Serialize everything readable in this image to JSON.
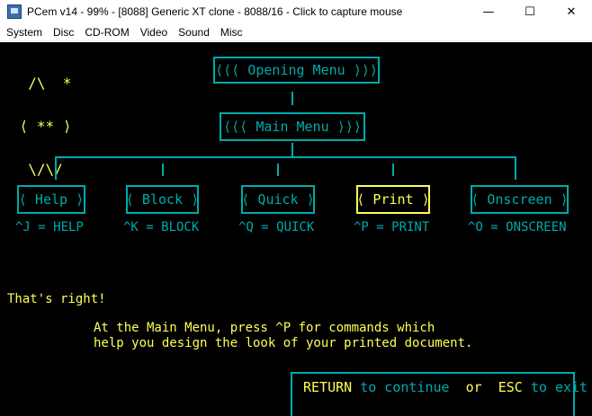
{
  "window": {
    "title": "PCem v14 - 99% - [8088] Generic XT clone - 8088/16 - Click to capture mouse",
    "minimize_glyph": "—",
    "maximize_glyph": "☐",
    "close_glyph": "✕"
  },
  "menubar": {
    "items": [
      "System",
      "Disc",
      "CD-ROM",
      "Video",
      "Sound",
      "Misc"
    ]
  },
  "screen": {
    "logo": {
      "lines": [
        "  /\\  *",
        " ⟨ ** ⟩ ",
        "  \\/\\/"
      ]
    },
    "opening_menu": "⟨⟨⟨ Opening Menu ⟩⟩⟩",
    "main_menu": "⟨⟨⟨ Main Menu ⟩⟩⟩",
    "submenus": [
      {
        "label": "⟨ Help ⟩",
        "shortcut": "^J = HELP"
      },
      {
        "label": "⟨ Block ⟩",
        "shortcut": "^K = BLOCK"
      },
      {
        "label": "⟨ Quick ⟩",
        "shortcut": "^Q = QUICK"
      },
      {
        "label": "⟨ Print ⟩",
        "shortcut": "^P = PRINT"
      },
      {
        "label": "⟨ Onscreen ⟩",
        "shortcut": "^O = ONSCREEN"
      }
    ],
    "selected_submenu": "Print",
    "feedback": "That's right!",
    "message_line1": "At the Main Menu, press ^P for commands which",
    "message_line2": "help you design the look of your printed document.",
    "footer": {
      "key1": "RETURN",
      "text1": "to continue",
      "or": "or",
      "key2": "ESC",
      "text2": "to exit"
    },
    "colors": {
      "cyan": "#00aaaa",
      "yellow": "#ffff55",
      "background": "#000000"
    }
  }
}
